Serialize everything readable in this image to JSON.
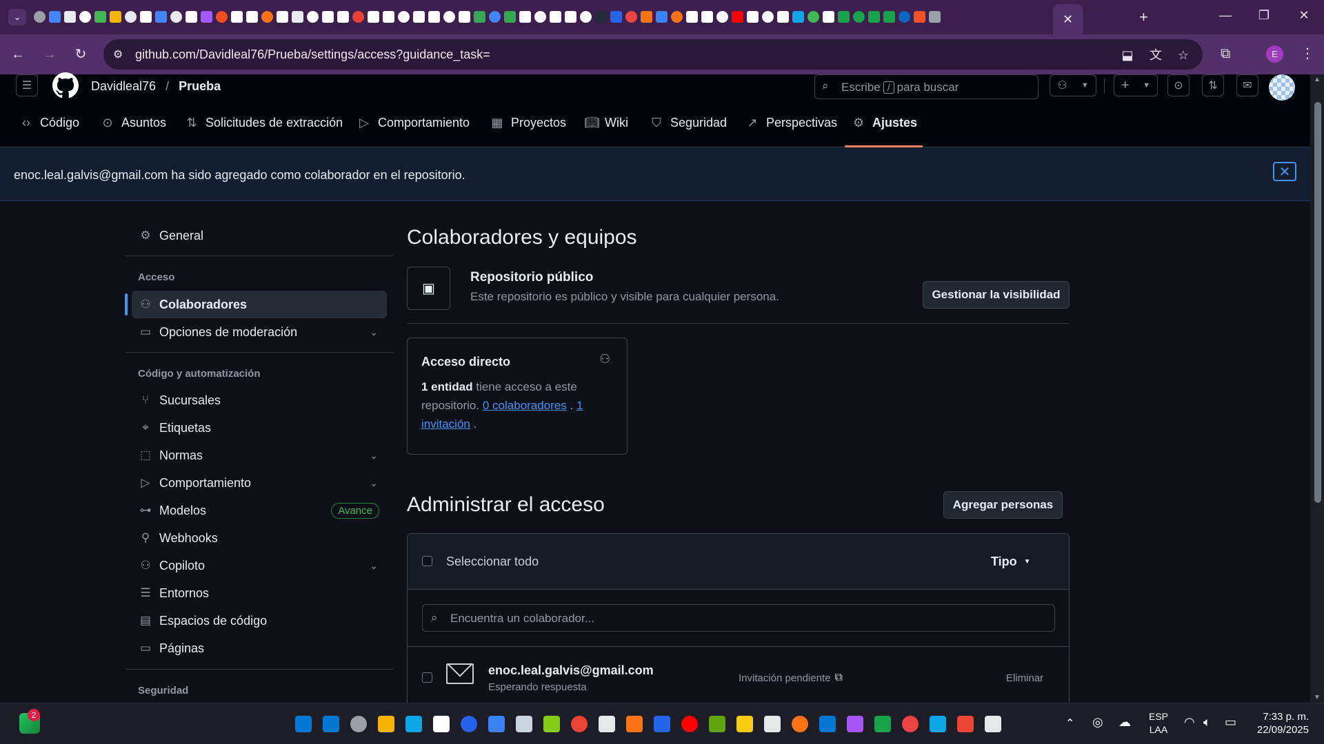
{
  "browser": {
    "url": "github.com/Davidleal76/Prueba/settings/access?guidance_task=",
    "profile_initial": "E",
    "tab_icon_colors": [
      "#9aa0a6",
      "#4285f4",
      "#e8eaed",
      "#ffffff",
      "#3fb950",
      "#f4b400",
      "#e8eaed",
      "#ffffff",
      "#4285f4",
      "#e8eaed",
      "#ffffff",
      "#a259ff",
      "#f24e1e",
      "#ffffff",
      "#ffffff",
      "#f97316",
      "#ffffff",
      "#e8eaed",
      "#ffffff",
      "#ffffff",
      "#ffffff",
      "#ea4335",
      "#ffffff",
      "#ffffff",
      "#ffffff",
      "#ffffff",
      "#ffffff",
      "#ffffff",
      "#ffffff",
      "#34a853",
      "#4285f4",
      "#34a853",
      "#ffffff",
      "#ffffff",
      "#ffffff",
      "#ffffff",
      "#ffffff",
      "#1f2937",
      "#2563eb",
      "#ef4444",
      "#f97316",
      "#3b82f6",
      "#f97316",
      "#ffffff",
      "#ffffff",
      "#ffffff",
      "#ff0000",
      "#ffffff",
      "#ffffff",
      "#ffffff",
      "#0ea5e9",
      "#3fb950",
      "#ffffff",
      "#16a34a",
      "#16a34a",
      "#16a34a",
      "#16a34a",
      "#0a66c2",
      "#f25022",
      "#9aa0a6",
      "#7c3aed"
    ],
    "window_controls": {
      "minimize": "—",
      "restore": "❐",
      "close": "✕"
    }
  },
  "header": {
    "owner": "Davidleal76",
    "separator": "/",
    "repo": "Prueba",
    "search_prefix": "Escribe",
    "search_key": "/",
    "search_suffix": "para buscar"
  },
  "repo_nav": [
    {
      "label": "Código",
      "icon": "code-icon"
    },
    {
      "label": "Asuntos",
      "icon": "issue-icon"
    },
    {
      "label": "Solicitudes de extracción",
      "icon": "pull-request-icon"
    },
    {
      "label": "Comportamiento",
      "icon": "play-icon"
    },
    {
      "label": "Proyectos",
      "icon": "table-icon"
    },
    {
      "label": "Wiki",
      "icon": "book-icon"
    },
    {
      "label": "Seguridad",
      "icon": "shield-icon"
    },
    {
      "label": "Perspectivas",
      "icon": "graph-icon"
    },
    {
      "label": "Ajustes",
      "icon": "gear-icon",
      "active": true
    }
  ],
  "flash": {
    "message": "enoc.leal.galvis@gmail.com ha sido agregado como colaborador en el repositorio.",
    "close": "✕"
  },
  "sidebar": {
    "general": "General",
    "section_access": "Acceso",
    "collaborators": "Colaboradores",
    "moderation": "Opciones de moderación",
    "section_code": "Código y automatización",
    "items": [
      {
        "label": "Sucursales",
        "icon": "branch-icon"
      },
      {
        "label": "Etiquetas",
        "icon": "tag-icon"
      },
      {
        "label": "Normas",
        "icon": "rules-icon",
        "expandable": true
      },
      {
        "label": "Comportamiento",
        "icon": "play-icon",
        "expandable": true
      },
      {
        "label": "Modelos",
        "icon": "models-icon",
        "badge": "Avance"
      },
      {
        "label": "Webhooks",
        "icon": "webhook-icon"
      },
      {
        "label": "Copiloto",
        "icon": "copilot-icon",
        "expandable": true
      },
      {
        "label": "Entornos",
        "icon": "server-icon"
      },
      {
        "label": "Espacios de código",
        "icon": "codespaces-icon"
      },
      {
        "label": "Páginas",
        "icon": "browser-icon"
      }
    ],
    "section_security": "Seguridad"
  },
  "main": {
    "title": "Colaboradores y equipos",
    "visibility": {
      "heading": "Repositorio público",
      "description": "Este repositorio es público y visible para cualquier persona.",
      "button": "Gestionar la visibilidad"
    },
    "direct_access": {
      "heading": "Acceso directo",
      "count": "1 entidad",
      "text1": " tiene acceso a este repositorio.",
      "collab_link": "0 colaboradores",
      "dot": " . ",
      "invite_link": "1 invitación",
      "end": " ."
    },
    "manage": {
      "title": "Administrar el acceso",
      "add_button": "Agregar personas",
      "select_all": "Seleccionar todo",
      "type_filter": "Tipo",
      "search_placeholder": "Encuentra un colaborador...",
      "rows": [
        {
          "email": "enoc.leal.galvis@gmail.com",
          "status": "Esperando respuesta",
          "state": "Invitación pendiente",
          "action": "Eliminar"
        }
      ]
    }
  },
  "taskbar": {
    "notification_count": "2",
    "lang_top": "ESP",
    "lang_bottom": "LAA",
    "time": "7:33 p. m.",
    "date": "22/09/2025",
    "icon_colors": [
      "#0078d4",
      "#0078d4",
      "#9aa0a6",
      "#f4b400",
      "#0ea5e9",
      "#ffffff",
      "#2563eb",
      "#3b82f6",
      "#cbd5e1",
      "#84cc16",
      "#ea4335",
      "#e5e7eb",
      "#f97316",
      "#2563eb",
      "#ff0000",
      "#65a30d",
      "#facc15",
      "#e5e7eb",
      "#f97316",
      "#0078d4",
      "#a855f7",
      "#16a34a",
      "#ef4444",
      "#0ea5e9",
      "#ea4335",
      "#e5e7eb"
    ]
  }
}
